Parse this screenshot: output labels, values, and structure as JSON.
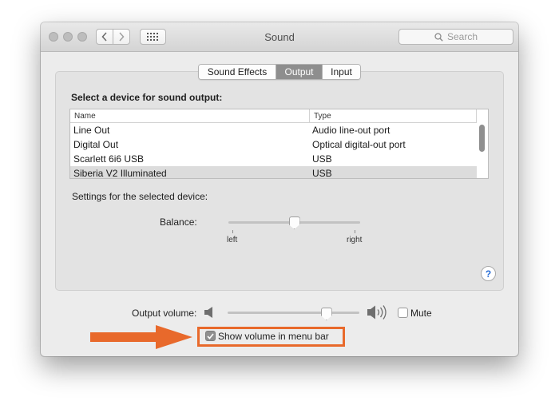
{
  "window": {
    "title": "Sound",
    "search_placeholder": "Search"
  },
  "tabs": [
    {
      "label": "Sound Effects",
      "selected": false
    },
    {
      "label": "Output",
      "selected": true
    },
    {
      "label": "Input",
      "selected": false
    }
  ],
  "output": {
    "section_title": "Select a device for sound output:",
    "columns": [
      "Name",
      "Type"
    ],
    "devices": [
      {
        "name": "Line Out",
        "type": "Audio line-out port",
        "selected": false
      },
      {
        "name": "Digital Out",
        "type": "Optical digital-out port",
        "selected": false
      },
      {
        "name": "Scarlett 6i6 USB",
        "type": "USB",
        "selected": false
      },
      {
        "name": "Siberia V2 Illuminated",
        "type": "USB",
        "selected": true
      }
    ],
    "settings_label": "Settings for the selected device:",
    "balance": {
      "label": "Balance:",
      "left_label": "left",
      "right_label": "right",
      "value": 0.5
    },
    "help": "?"
  },
  "volume": {
    "label": "Output volume:",
    "value": 0.75,
    "mute_label": "Mute",
    "mute_checked": false,
    "show_in_menu_label": "Show volume in menu bar",
    "show_in_menu_checked": true
  },
  "colors": {
    "highlight": "#e8692b",
    "selected_tab": "#8e8e8e",
    "help_accent": "#2b6fd6"
  }
}
